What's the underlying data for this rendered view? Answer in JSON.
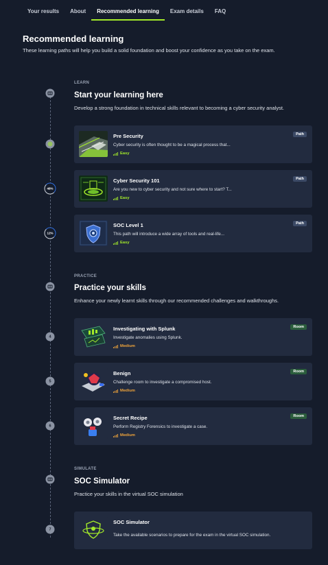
{
  "tabs": [
    {
      "label": "Your results"
    },
    {
      "label": "About"
    },
    {
      "label": "Recommended learning"
    },
    {
      "label": "Exam details"
    },
    {
      "label": "FAQ"
    }
  ],
  "active_tab": "Recommended learning",
  "header": {
    "title": "Recommended learning",
    "subtitle": "These learning paths will help you build a solid foundation and boost your confidence as you take on the exam."
  },
  "sections": {
    "learn": {
      "label": "LEARN",
      "title": "Start your learning here",
      "desc": "Develop a strong foundation in technical skills relevant to becoming a cyber security analyst.",
      "items": [
        {
          "title": "Pre Security",
          "desc": "Cyber security is often thought to be a magical process that...",
          "difficulty": "Easy",
          "badge": "Path",
          "progress": 100
        },
        {
          "title": "Cyber Security 101",
          "desc": "Are you new to cyber security and not sure where to start? T...",
          "difficulty": "Easy",
          "badge": "Path",
          "progress_label": "48%",
          "progress": 48
        },
        {
          "title": "SOC Level 1",
          "desc": "This path will introduce a wide array of tools and real-life...",
          "difficulty": "Easy",
          "badge": "Path",
          "progress_label": "12%",
          "progress": 12
        }
      ]
    },
    "practice": {
      "label": "PRACTICE",
      "title": "Practice your skills",
      "desc": "Enhance your newly learnt skills through our recommended challenges and walkthroughs.",
      "items": [
        {
          "num": "4",
          "title": "Investigating with Splunk",
          "desc": "Investigate anomalies using Splunk.",
          "difficulty": "Medium",
          "badge": "Room"
        },
        {
          "num": "5",
          "title": "Benign",
          "desc": "Challenge room to investigate a compromised host.",
          "difficulty": "Medium",
          "badge": "Room"
        },
        {
          "num": "6",
          "title": "Secret Recipe",
          "desc": "Perform Registry Forensics to investigate a case.",
          "difficulty": "Medium",
          "badge": "Room"
        }
      ]
    },
    "simulate": {
      "label": "SIMULATE",
      "title": "SOC Simulator",
      "desc": "Practice your skills in the virtual SOC simulation",
      "items": [
        {
          "num": "7",
          "title": "SOC Simulator",
          "desc": "Take the available scenarios to prepare for the exam in the virtual SOC simulation."
        }
      ]
    }
  },
  "colors": {
    "accent": "#a3ea2a",
    "medium": "#f0a43a",
    "background": "#151c2b",
    "card": "#222b3f"
  }
}
